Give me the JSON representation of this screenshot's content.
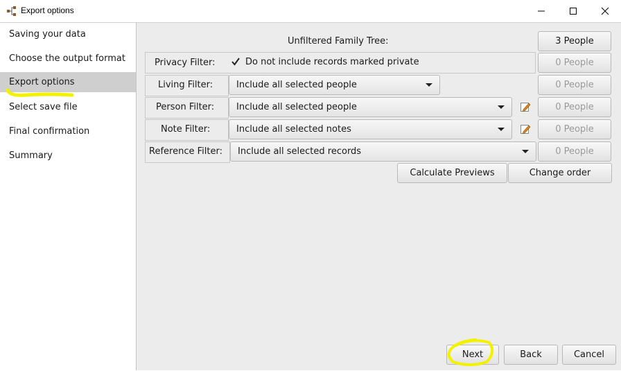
{
  "window": {
    "title": "Export options",
    "icon": "family-tree-app-icon"
  },
  "sidebar": {
    "items": [
      {
        "label": "Saving your data"
      },
      {
        "label": "Choose the output format"
      },
      {
        "label": "Export options"
      },
      {
        "label": "Select save file"
      },
      {
        "label": "Final confirmation"
      },
      {
        "label": "Summary"
      }
    ],
    "active_index": 2
  },
  "main": {
    "unfiltered_label": "Unfiltered Family Tree:",
    "unfiltered_count": "3 People",
    "privacy": {
      "label": "Privacy Filter:",
      "checkbox_label": "Do not include records marked private",
      "checked": true,
      "count": "0 People"
    },
    "living": {
      "label": "Living Filter:",
      "value": "Include all selected people",
      "count": "0 People"
    },
    "person": {
      "label": "Person Filter:",
      "value": "Include all selected people",
      "count": "0 People"
    },
    "note": {
      "label": "Note Filter:",
      "value": "Include all selected notes",
      "count": "0 People"
    },
    "reference": {
      "label": "Reference Filter:",
      "value": "Include all selected records",
      "count": "0 People"
    },
    "calculate_label": "Calculate Previews",
    "change_order_label": "Change order"
  },
  "footer": {
    "next_label": "Next",
    "back_label": "Back",
    "cancel_label": "Cancel"
  },
  "colors": {
    "highlight": "#f2f200",
    "panel": "#ececec",
    "sidebar_active": "#cfcfcf"
  }
}
